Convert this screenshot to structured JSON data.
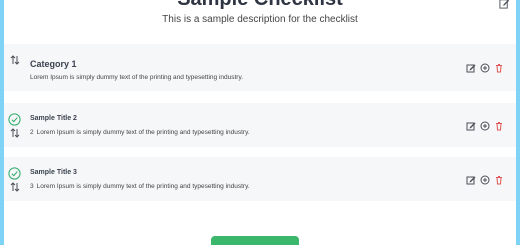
{
  "checklist": {
    "title": "Sample Checklist",
    "description": "This is a sample description for the checklist"
  },
  "category": {
    "title": "Category 1",
    "description": "Lorem Ipsum is simply dummy text of the printing and typesetting industry."
  },
  "items": [
    {
      "title": "Sample Title 2",
      "number": "2",
      "description": "Lorem Ipsum is simply dummy text of the printing and typesetting industry."
    },
    {
      "title": "Sample Title 3",
      "number": "3",
      "description": "Lorem Ipsum is simply dummy text of the printing and typesetting industry."
    }
  ],
  "icons": {
    "header": "edit-icon",
    "drag": "sort-arrows-icon",
    "check": "check-circle-icon",
    "edit": "edit-icon",
    "add": "plus-circle-icon",
    "delete": "trash-icon"
  },
  "colors": {
    "background": "#7fd3f7",
    "card": "#f6f7f8",
    "check": "#2eaa6b",
    "delete": "#e05555",
    "action": "#4a4f57",
    "submit": "#3ab76a"
  }
}
